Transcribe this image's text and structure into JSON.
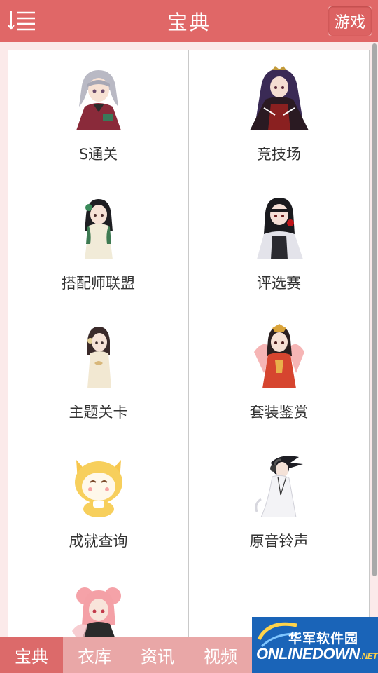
{
  "header": {
    "title": "宝典",
    "menu_icon": "menu-list-icon",
    "game_button": "游戏"
  },
  "grid": {
    "items": [
      {
        "label": "S通关",
        "image": "silver-hair-girl-avatar"
      },
      {
        "label": "竞技场",
        "image": "dark-queen-avatar"
      },
      {
        "label": "搭配师联盟",
        "image": "qipao-girl-avatar"
      },
      {
        "label": "评选赛",
        "image": "gothic-girl-avatar"
      },
      {
        "label": "主题关卡",
        "image": "cheongsam-girl-avatar"
      },
      {
        "label": "套装鉴赏",
        "image": "chinese-bride-avatar"
      },
      {
        "label": "成就查询",
        "image": "cat-mascot-avatar"
      },
      {
        "label": "原音铃声",
        "image": "headphone-girl-avatar"
      },
      {
        "label": "",
        "image": "pink-hair-girl-avatar"
      },
      {
        "label": "",
        "image": ""
      }
    ]
  },
  "tabs": [
    {
      "label": "宝典",
      "active": true
    },
    {
      "label": "衣库",
      "active": false
    },
    {
      "label": "资讯",
      "active": false
    },
    {
      "label": "视频",
      "active": false
    }
  ],
  "watermark": {
    "top_text": "华军软件园",
    "bottom_text": "ONLINEDOWN",
    "suffix": ".NET"
  },
  "colors": {
    "header": "#e06767",
    "tabbar": "#e9a7a7",
    "active_tab": "#dc6a6a",
    "background": "#fbeaea"
  }
}
